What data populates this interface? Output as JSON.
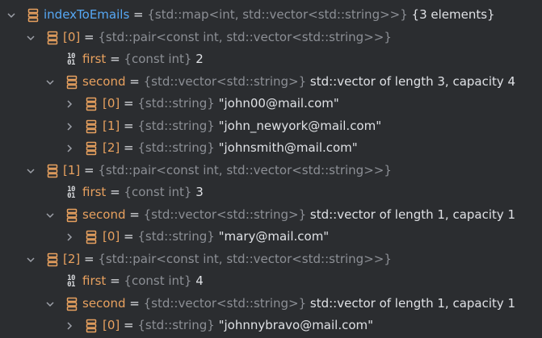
{
  "root": {
    "name": "indexToEmails",
    "eq": " = ",
    "type": "{std::map<int, std::vector<std::string>>}",
    "value": " {3 elements}",
    "icon": "array-icon",
    "expanded": true
  },
  "entries": [
    {
      "name": "[0]",
      "eq": " = ",
      "type": "{std::pair<const int, std::vector<std::string>>}",
      "first": {
        "name": "first",
        "eq": " = ",
        "type": "{const int}",
        "value": " 2",
        "icon": "binary-icon"
      },
      "second": {
        "name": "second",
        "eq": " = ",
        "type": "{std::vector<std::string>}",
        "value": " std::vector of length 3, capacity 4",
        "items": [
          {
            "name": "[0]",
            "eq": " = ",
            "type": "{std::string}",
            "value": " \"john00@mail.com\""
          },
          {
            "name": "[1]",
            "eq": " = ",
            "type": "{std::string}",
            "value": " \"john_newyork@mail.com\""
          },
          {
            "name": "[2]",
            "eq": " = ",
            "type": "{std::string}",
            "value": " \"johnsmith@mail.com\""
          }
        ]
      }
    },
    {
      "name": "[1]",
      "eq": " = ",
      "type": "{std::pair<const int, std::vector<std::string>>}",
      "first": {
        "name": "first",
        "eq": " = ",
        "type": "{const int}",
        "value": " 3",
        "icon": "binary-icon"
      },
      "second": {
        "name": "second",
        "eq": " = ",
        "type": "{std::vector<std::string>}",
        "value": " std::vector of length 1, capacity 1",
        "items": [
          {
            "name": "[0]",
            "eq": " = ",
            "type": "{std::string}",
            "value": " \"mary@mail.com\""
          }
        ]
      }
    },
    {
      "name": "[2]",
      "eq": " = ",
      "type": "{std::pair<const int, std::vector<std::string>>}",
      "first": {
        "name": "first",
        "eq": " = ",
        "type": "{const int}",
        "value": " 4",
        "icon": "binary-icon"
      },
      "second": {
        "name": "second",
        "eq": " = ",
        "type": "{std::vector<std::string>}",
        "value": " std::vector of length 1, capacity 1",
        "items": [
          {
            "name": "[0]",
            "eq": " = ",
            "type": "{std::string}",
            "value": " \"johnnybravo@mail.com\""
          }
        ]
      }
    }
  ],
  "binary_icon_glyph": {
    "top": "10",
    "bottom": "01"
  },
  "colors": {
    "background": "#2b2d30",
    "root_name": "#56a8f5",
    "child_name": "#e8a15f",
    "type": "#8c8f95",
    "value": "#dfe1e5",
    "icon_stroke": "#e8a15f",
    "arrow": "#9da0a8"
  }
}
